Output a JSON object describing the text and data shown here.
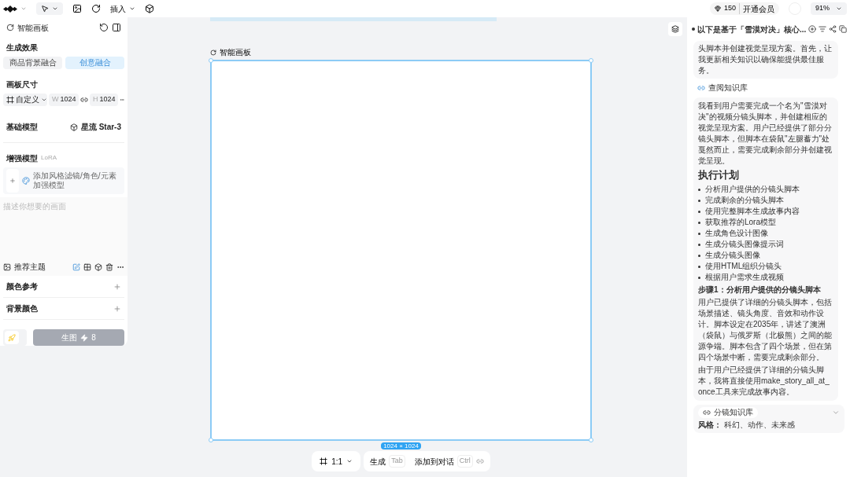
{
  "toolbar": {
    "insert_menu": "插入",
    "credits": "150",
    "membership": "开通会员",
    "zoom": "91%"
  },
  "left_panel": {
    "title": "智能画板",
    "effect": {
      "label": "生成效果",
      "options": [
        {
          "label": "商品背景融合",
          "selected": false
        },
        {
          "label": "创意融合",
          "selected": true
        }
      ]
    },
    "size": {
      "label": "画板尺寸",
      "preset": "自定义",
      "width": {
        "prefix": "W",
        "value": "1024"
      },
      "height": {
        "prefix": "H",
        "value": "1024"
      }
    },
    "base_model": {
      "label": "基础模型",
      "value": "星流 Star-3"
    },
    "enhance_model": {
      "label": "增强模型",
      "tag": "LoRA",
      "add_hint": "添加风格滤镜/角色/元素加强模型"
    },
    "prompt": {
      "placeholder": "描述你想要的画面",
      "theme": "推荐主题"
    },
    "sections": [
      "颜色参考",
      "背景颜色"
    ],
    "generate": {
      "label": "生图",
      "cost": "8",
      "disabled": true
    }
  },
  "canvas": {
    "label": "智能画板",
    "size_badge": "1024 × 1024",
    "ratio": "1:1",
    "actions": [
      {
        "label": "生成",
        "key": "Tab"
      },
      {
        "label": "添加到对话",
        "key": "Ctrl"
      }
    ]
  },
  "chat": {
    "title": "以下是基于「雪漠对决」核心...",
    "intro": "头脚本并创建视觉呈现方案。首先，让我更新相关知识以确保能提供最佳服务。",
    "link": "查阅知识库",
    "analysis": "我看到用户需要完成一个名为\"雪漠对决\"的视频分镜头脚本，并创建相应的视觉呈现方案。用户已经提供了部分分镜头脚本，但脚本在袋鼠\"左腿蓄力\"处戛然而止，需要完成剩余部分并创建视觉呈现。",
    "plan_title": "执行计划",
    "plan": [
      "分析用户提供的分镜头脚本",
      "完成剩余的分镜头脚本",
      "使用完整脚本生成故事内容",
      "获取推荐的Lora模型",
      "生成角色设计图像",
      "生成分镜头图像提示词",
      "生成分镜头图像",
      "使用HTML组织分镜头",
      "根据用户需求生成视频"
    ],
    "step_title": "步骤1：分析用户提供的分镜头脚本",
    "step_paragraphs": [
      "用户已提供了详细的分镜头脚本，包括场景描述、镜头角度、音效和动作设计。脚本设定在2035年，讲述了澳洲（袋鼠）与俄罗斯（北极熊）之间的能源争端。脚本包含了四个场景，但在第四个场景中断，需要完成剩余部分。",
      "由于用户已经提供了详细的分镜头脚本，我将直接使用make_story_all_at_once工具来完成故事内容。"
    ],
    "knowledge": {
      "tag": "分镜知识库",
      "style": "**风格：** 科幻、动作、未来感"
    }
  }
}
